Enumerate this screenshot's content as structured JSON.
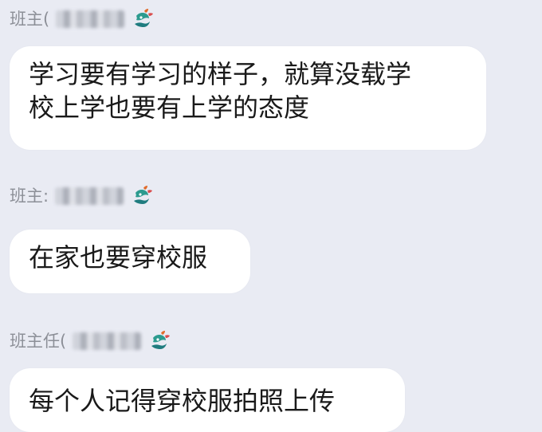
{
  "messages": [
    {
      "sender": "班主(",
      "text_line1": "学习要有学习的样子，就算没载学",
      "text_line2": "校上学也要有上学的态度"
    },
    {
      "sender": "班主:",
      "text_line1": "在家也要穿校服"
    },
    {
      "sender": "班主任(",
      "text_line1": "每个人记得穿校服拍照上传"
    }
  ],
  "colors": {
    "background": "#e9ebf3",
    "bubble": "#ffffff",
    "sender_text": "#8c8f97",
    "message_text": "#191919"
  },
  "icons": {
    "badge": "dragon-badge-icon"
  }
}
